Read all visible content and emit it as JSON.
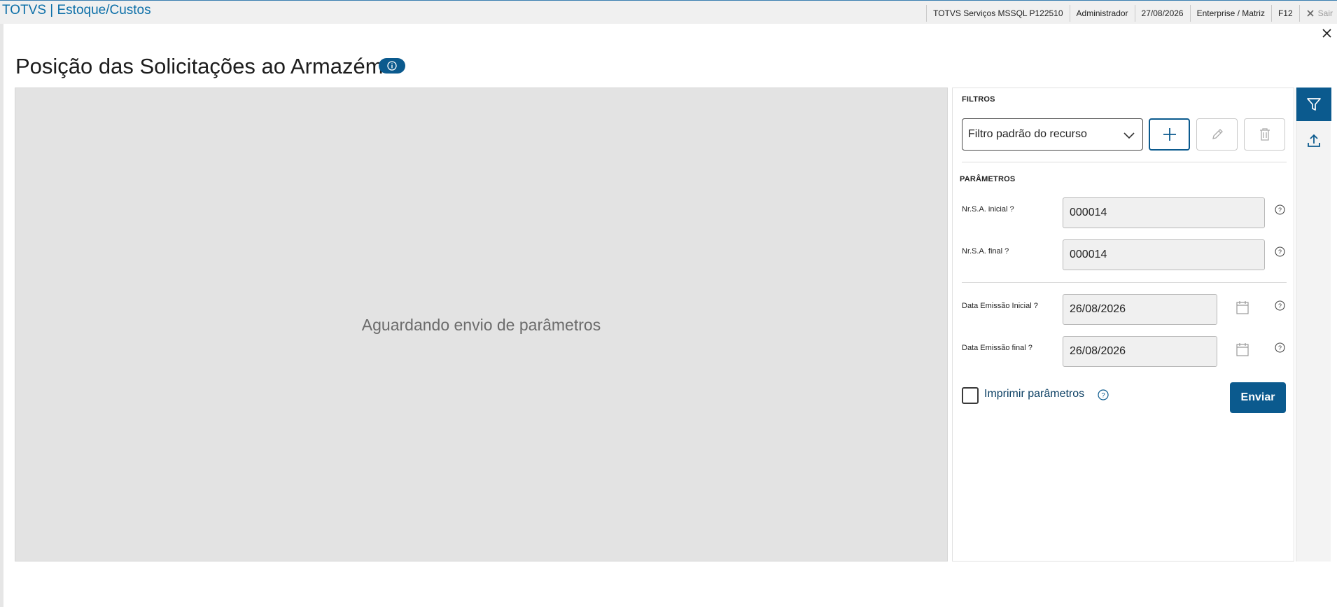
{
  "topbar": {
    "brand": "TOTVS | Estoque/Custos",
    "items": [
      "TOTVS Serviços MSSQL P122510",
      "Administrador",
      "27/08/2026",
      "Enterprise / Matriz",
      "F12"
    ],
    "exit_label": "Sair"
  },
  "page": {
    "title": "Posição das Solicitações ao Armazém",
    "info_icon": "info-icon",
    "close_icon": "close-icon"
  },
  "preview": {
    "message": "Aguardando envio de parâmetros"
  },
  "filters": {
    "section_label": "FILTROS",
    "selected_filter": "Filtro padrão do recurso",
    "add_icon": "plus-icon",
    "edit_icon": "pencil-icon",
    "delete_icon": "trash-icon"
  },
  "parameters": {
    "section_label": "PARÂMETROS",
    "fields": [
      {
        "label": "Nr.S.A. inicial ?",
        "value": "000014"
      },
      {
        "label": "Nr.S.A. final ?",
        "value": "000014"
      },
      {
        "label": "Data Emissão Inicial ?",
        "value": "26/08/2026"
      },
      {
        "label": "Data Emissão final ?",
        "value": "26/08/2026"
      }
    ],
    "print_params_label": "Imprimir parâmetros",
    "print_params_checked": false,
    "send_label": "Enviar"
  },
  "colors": {
    "brand_blue": "#0b5a8e",
    "brand_link": "#0c6fa8"
  }
}
